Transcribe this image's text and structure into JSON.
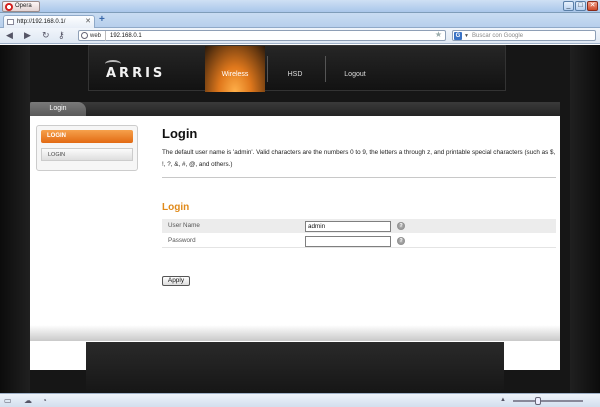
{
  "browser": {
    "app_button": "Opera",
    "window_buttons": {
      "minimize": "_",
      "maximize": "□",
      "close": "✕"
    },
    "tab": {
      "title": "http://192.168.0.1/",
      "close": "✕"
    },
    "new_tab": "+",
    "address": {
      "prefix": "web",
      "url": "192.168.0.1"
    },
    "search": {
      "engine": "G",
      "placeholder": "Buscar con Google"
    }
  },
  "router": {
    "logo": "ARRIS",
    "menu": [
      {
        "label": "Wireless",
        "active": true
      },
      {
        "label": "HSD",
        "active": false
      },
      {
        "label": "Logout",
        "active": false
      }
    ],
    "page_tab": "Login",
    "sidebar": {
      "active": "LOGIN",
      "item": "LOGIN"
    },
    "title": "Login",
    "description": "The default user name is 'admin'. Valid characters are the numbers 0 to 9, the letters a through z, and printable special characters (such as $, !, ?, &, #, @, and others.)",
    "section_title": "Login",
    "form": {
      "username_label": "User Name",
      "username_value": "admin",
      "password_label": "Password",
      "password_value": "",
      "help": "?"
    },
    "apply_label": "Apply"
  },
  "colors": {
    "accent": "#e26a13",
    "section_title": "#e08a1a"
  }
}
